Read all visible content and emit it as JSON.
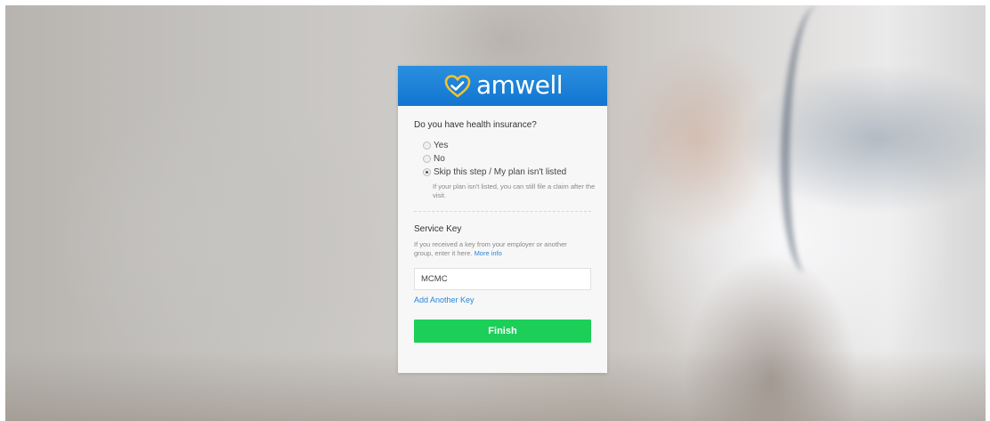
{
  "brand": {
    "name": "amwell",
    "colors": {
      "header": "#1275cf",
      "accent": "#2c85d6",
      "button": "#1ccf58"
    },
    "icon": "heart-check-icon"
  },
  "insurance": {
    "question": "Do you have health insurance?",
    "options": [
      {
        "label": "Yes",
        "selected": false
      },
      {
        "label": "No",
        "selected": false
      },
      {
        "label": "Skip this step / My plan isn't listed",
        "selected": true
      }
    ],
    "hint": "If your plan isn't listed, you can still file a claim after the visit."
  },
  "service_key": {
    "title": "Service Key",
    "description": "If you received a key from your employer or another group, enter it here.",
    "more_info_label": "More info",
    "value": "MCMC",
    "placeholder": "",
    "add_key_label": "Add Another Key"
  },
  "actions": {
    "finish_label": "Finish"
  }
}
